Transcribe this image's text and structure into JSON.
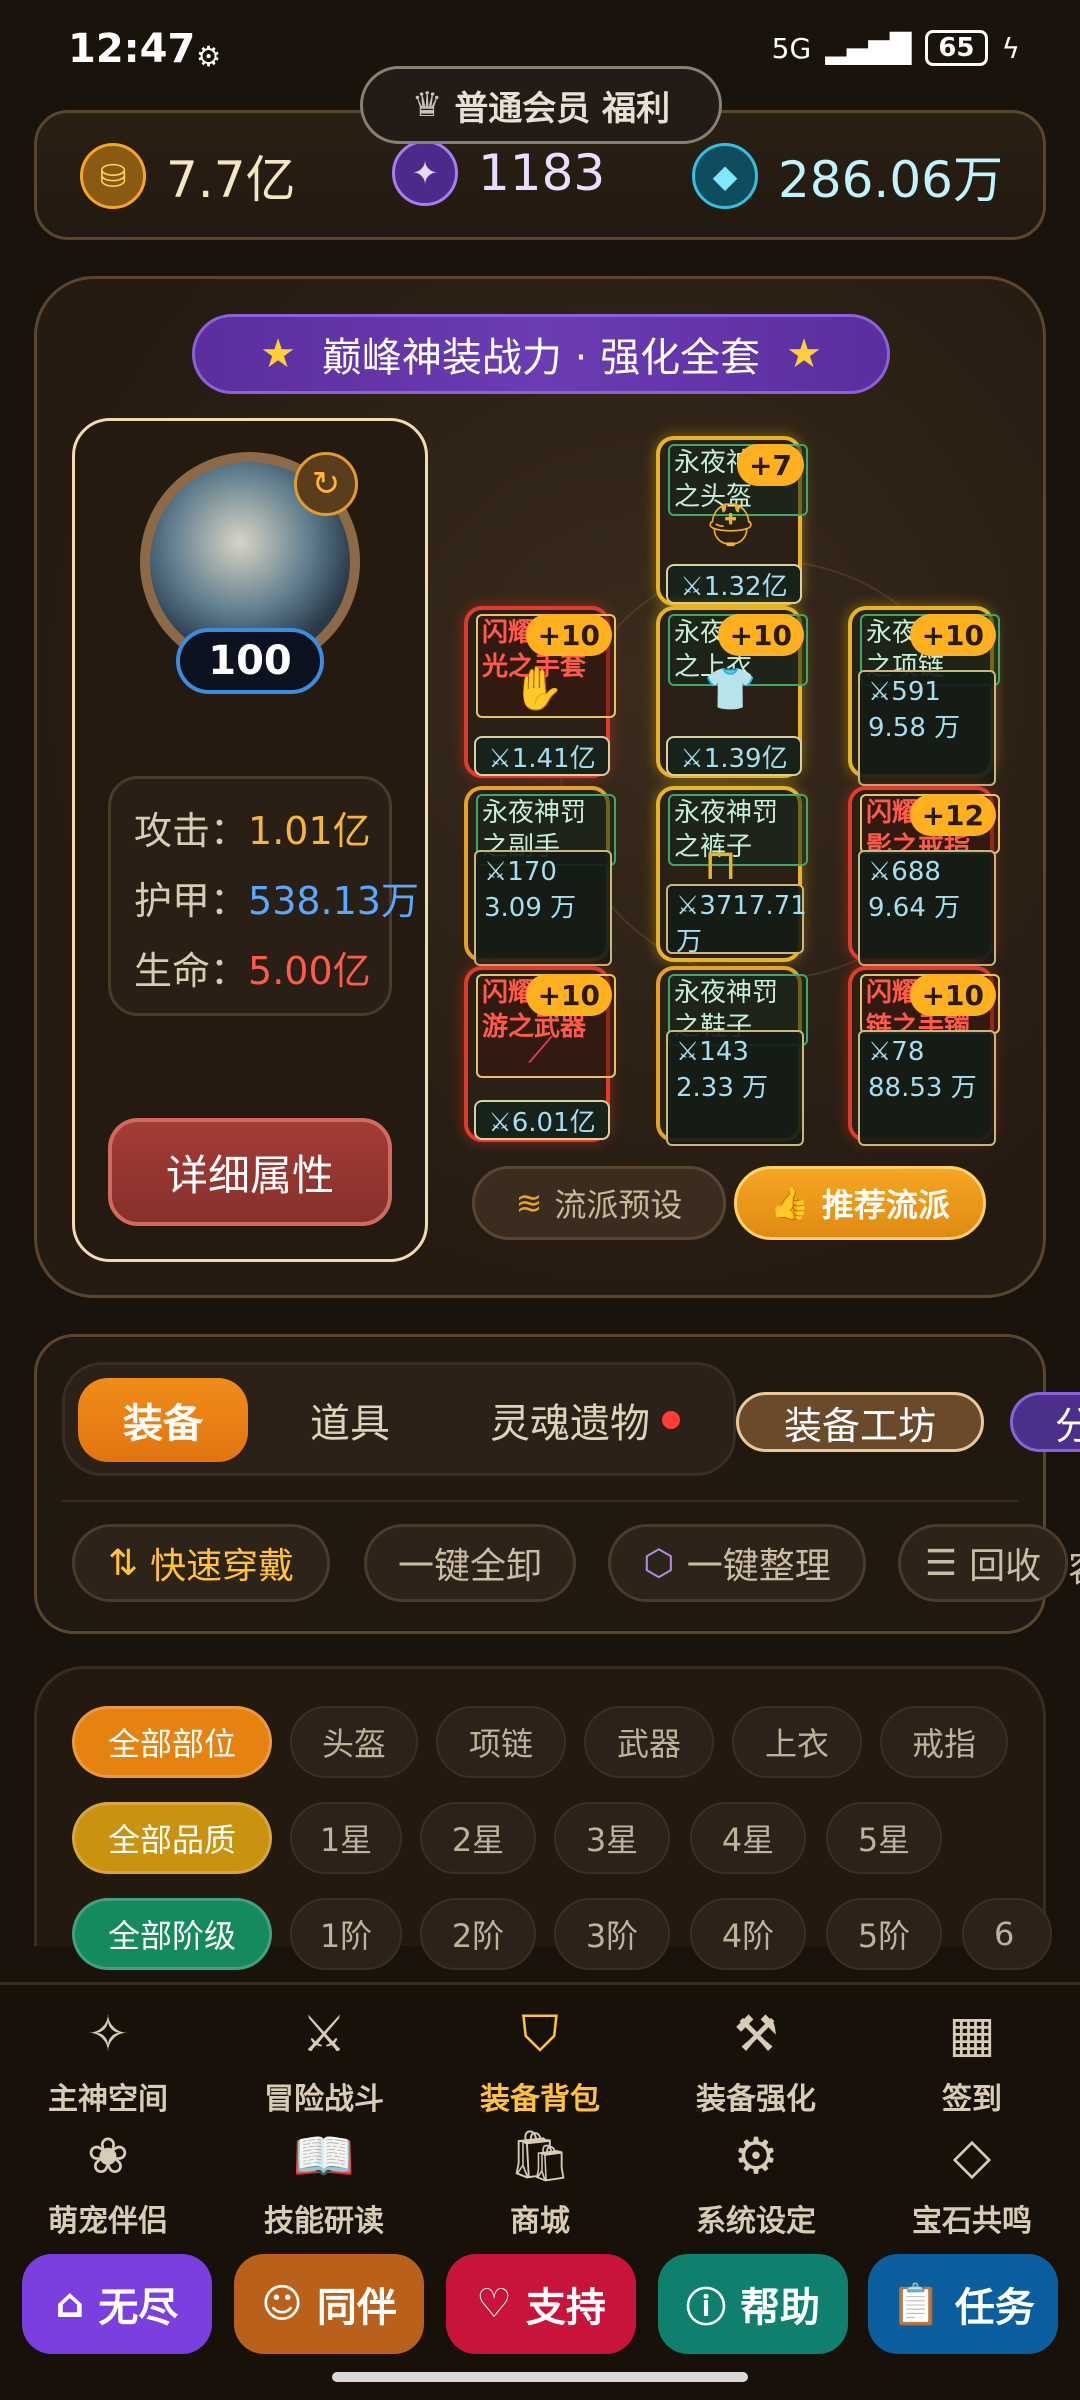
{
  "status": {
    "time": "12:47",
    "network": "5G",
    "battery": "65"
  },
  "vip": {
    "label": "普通会员 福利"
  },
  "currency": {
    "gold": "7.7亿",
    "stars": "1183",
    "diamonds": "286.06万"
  },
  "banner": {
    "title": "巅峰神装战力 · 强化全套",
    "star": "★"
  },
  "character": {
    "level": "100",
    "stats": [
      {
        "label": "攻击：",
        "value": "1.01亿",
        "color": "#f5b63a"
      },
      {
        "label": "护甲：",
        "value": "538.13万",
        "color": "#5aa8ff"
      },
      {
        "label": "生命：",
        "value": "5.00亿",
        "color": "#ff5a4a"
      }
    ],
    "detail_button": "详细属性"
  },
  "slots": {
    "helmet": {
      "name": "永夜神罚之头盔",
      "plus": "+7",
      "power": "⚔1.32亿"
    },
    "glove": {
      "name": "闪耀星流光之手套",
      "plus": "+10",
      "power": "⚔1.41亿"
    },
    "top": {
      "name": "永夜神罚之上衣",
      "plus": "+10",
      "power": "⚔1.39亿"
    },
    "necklace": {
      "name": "永夜神罚之项链",
      "plus": "+10",
      "power": "⚔591 9.58 万"
    },
    "offhand": {
      "name": "永夜神罚之副手",
      "power": "⚔170 3.09 万"
    },
    "pants": {
      "name": "永夜神罚之裤子",
      "power": "⚔3717.71 万"
    },
    "ring": {
      "name": "闪耀辉耀影之戒指",
      "plus": "+12",
      "power": "⚔688 9.64 万"
    },
    "weapon": {
      "name": "闪耀空漫游之武器",
      "plus": "+10",
      "power": "⚔6.01亿"
    },
    "shoes": {
      "name": "永夜神罚之鞋子",
      "power": "⚔143 2.33 万"
    },
    "bracelet": {
      "name": "闪耀魂锁链之手镯",
      "plus": "+10",
      "power": "⚔78 88.53 万"
    }
  },
  "preset_button": "流派预设",
  "recommend_button": "推荐流派",
  "tabs": {
    "equip": "装备",
    "items": "道具",
    "relics": "灵魂遗物",
    "workshop": "装备工坊",
    "share": "分"
  },
  "actions": {
    "quick_wear": "快速穿戴",
    "unequip_all": "一键全卸",
    "organize": "一键整理",
    "recycle": "回收",
    "overflow": "容"
  },
  "filters": {
    "slot": [
      "全部部位",
      "头盔",
      "项链",
      "武器",
      "上衣",
      "戒指"
    ],
    "quality": [
      "全部品质",
      "1星",
      "2星",
      "3星",
      "4星",
      "5星"
    ],
    "tier": [
      "全部阶级",
      "1阶",
      "2阶",
      "3阶",
      "4阶",
      "5阶",
      "6"
    ]
  },
  "nav": [
    {
      "label": "主神空间",
      "icon": "sparkle-icon"
    },
    {
      "label": "冒险战斗",
      "icon": "swords-icon"
    },
    {
      "label": "装备背包",
      "icon": "shield-icon"
    },
    {
      "label": "装备强化",
      "icon": "hammer-icon"
    },
    {
      "label": "签到",
      "icon": "calendar-icon"
    },
    {
      "label": "萌宠伴侣",
      "icon": "paw-icon"
    },
    {
      "label": "技能研读",
      "icon": "book-icon"
    },
    {
      "label": "商城",
      "icon": "bag-icon"
    },
    {
      "label": "系统设定",
      "icon": "gear-icon"
    },
    {
      "label": "宝石共鸣",
      "icon": "gem-icon"
    }
  ],
  "quick": {
    "endless": {
      "label": "无尽",
      "color": "#7b3fe0"
    },
    "companion": {
      "label": "同伴",
      "color": "#b9601a"
    },
    "support": {
      "label": "支持",
      "color": "#c8143a"
    },
    "help": {
      "label": "帮助",
      "color": "#10806e"
    },
    "tasks": {
      "label": "任务",
      "color": "#0c5f9e"
    }
  }
}
